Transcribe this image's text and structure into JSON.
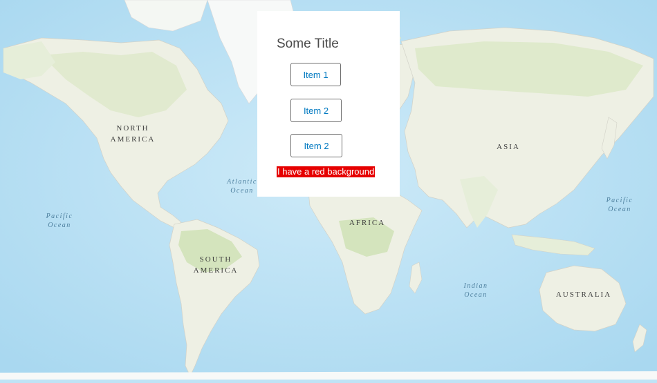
{
  "panel": {
    "title": "Some Title",
    "items": [
      {
        "label": "Item 1"
      },
      {
        "label": "Item 2"
      },
      {
        "label": "Item 2"
      }
    ],
    "red_text": "I have a red background",
    "red_color": "#e60000"
  },
  "map": {
    "continents": {
      "north_america": [
        "NORTH",
        "AMERICA"
      ],
      "south_america": [
        "SOUTH",
        "AMERICA"
      ],
      "africa": [
        "AFRICA"
      ],
      "asia": [
        "ASIA"
      ],
      "australia": [
        "AUSTRALIA"
      ]
    },
    "oceans": {
      "atlantic": [
        "Atlantic",
        "Ocean"
      ],
      "pacific_west": [
        "Pacific",
        "Ocean"
      ],
      "pacific_east": [
        "Pacific",
        "Ocean"
      ],
      "indian": [
        "Indian",
        "Ocean"
      ]
    },
    "colors": {
      "water": "#bfe3f6",
      "land": "#eef0e4",
      "vegetation": "#d8e6c2",
      "ice": "#f9fbfc"
    }
  }
}
